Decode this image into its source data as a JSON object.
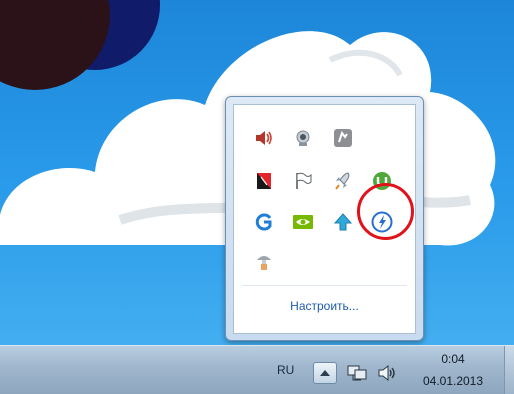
{
  "tray_flyout": {
    "icons": [
      {
        "name": "speaker-muted-icon"
      },
      {
        "name": "webcam-icon"
      },
      {
        "name": "phone-app-icon"
      },
      {
        "name": "kaspersky-icon"
      },
      {
        "name": "action-center-flag-icon"
      },
      {
        "name": "rocket-icon"
      },
      {
        "name": "utorrent-icon"
      },
      {
        "name": "g-app-icon"
      },
      {
        "name": "nvidia-icon"
      },
      {
        "name": "upload-arrow-icon"
      },
      {
        "name": "lightning-app-icon"
      },
      {
        "name": "mushroom-hand-icon"
      }
    ],
    "customize_label": "Настроить..."
  },
  "taskbar": {
    "language": "RU",
    "clock_time": "0:04",
    "clock_date": "04.01.2013"
  },
  "colors": {
    "highlight_ring": "#e0121b",
    "link": "#1e5ca8"
  }
}
